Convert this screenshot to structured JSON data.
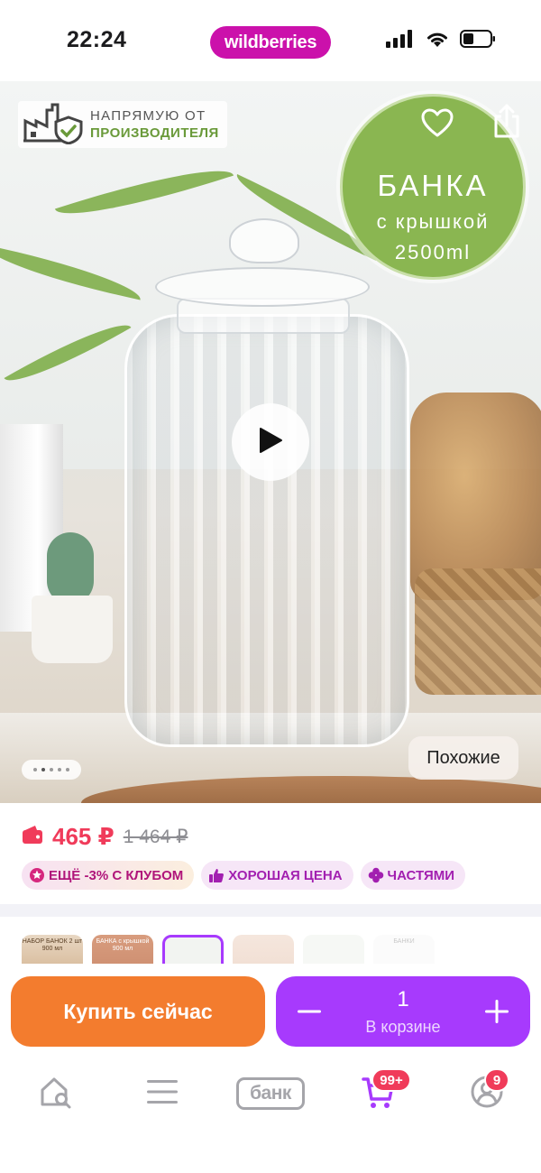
{
  "status_bar": {
    "time": "22:24",
    "brand": "wildberries"
  },
  "hero": {
    "badge_direct_line1": "НАПРЯМУЮ ОТ",
    "badge_direct_line2": "ПРОИЗВОДИТЕЛЯ",
    "circle_title": "БАНКА",
    "circle_subtitle": "с крышкой",
    "circle_volume": "2500ml",
    "similar_label": "Похожие",
    "gallery_total": 5,
    "gallery_active_index": 2
  },
  "price": {
    "current": "465 ₽",
    "old": "1 464 ₽",
    "tags": [
      {
        "label": "ЕЩЁ -3% С КЛУБОМ"
      },
      {
        "label": "ХОРОШАЯ ЦЕНА"
      },
      {
        "label": "ЧАСТЯМИ"
      }
    ]
  },
  "thumbnails": [
    {
      "text": "НАБОР БАНОК 2 шт 900 мл"
    },
    {
      "text": "БАНКА с крышкой 900 мл"
    },
    {
      "text": ""
    },
    {
      "text": ""
    },
    {
      "text": ""
    },
    {
      "text": "БАНКИ"
    }
  ],
  "actions": {
    "buy_now": "Купить сейчас",
    "cart_qty": "1",
    "cart_status": "В корзине"
  },
  "tab_bar": {
    "bank_label": "банк",
    "cart_badge": "99+",
    "profile_badge": "9",
    "accent_color": "#a73afd"
  },
  "colors": {
    "brand": "#cb11ab",
    "price": "#f03b5a",
    "buy_now": "#f37c2e",
    "cart": "#a73afd"
  }
}
